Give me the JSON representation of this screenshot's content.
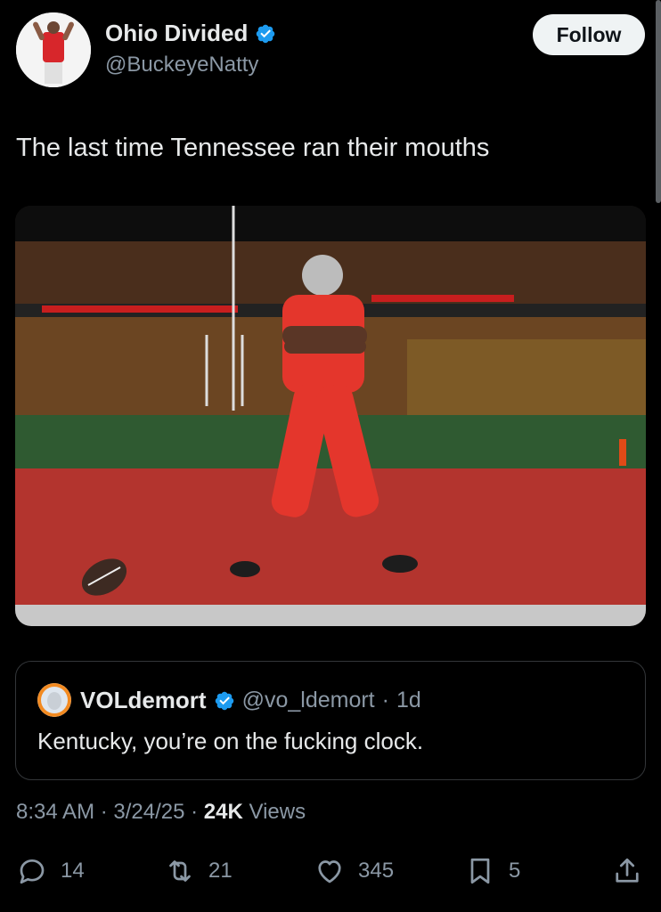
{
  "author": {
    "display_name": "Ohio Divided",
    "handle": "@BuckeyeNatty",
    "verified": true,
    "follow_label": "Follow"
  },
  "tweet": {
    "text": "The last time Tennessee ran their mouths"
  },
  "quote": {
    "display_name": "VOLdemort",
    "handle": "@vo_ldemort",
    "separator": "·",
    "age": "1d",
    "text": "Kentucky, you’re on the fucking clock."
  },
  "meta": {
    "time": "8:34 AM",
    "sep1": " · ",
    "date": "3/24/25",
    "sep2": " · ",
    "views_count": "24K",
    "views_label": " Views"
  },
  "actions": {
    "replies": "14",
    "reposts": "21",
    "likes": "345",
    "bookmarks": "5"
  },
  "colors": {
    "background": "#000000",
    "verified": "#1d9bf0",
    "muted": "#8b98a5",
    "text": "#e7e9ea"
  }
}
